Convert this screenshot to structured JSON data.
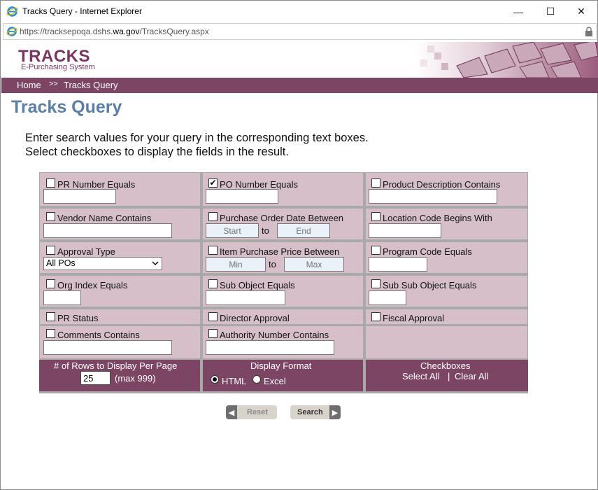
{
  "window": {
    "title": "Tracks Query - Internet Explorer",
    "minimize": "—",
    "maximize": "☐",
    "close": "✕"
  },
  "address": {
    "url_prefix": "https://trackse",
    "url_mid": "poqa.dshs",
    "url_domain": ".wa.gov",
    "url_path": "/TracksQuery.aspx"
  },
  "banner": {
    "logo": "TRACKS",
    "subtitle": "E-Purchasing System"
  },
  "nav": {
    "home": "Home",
    "sep": ">>",
    "current": "Tracks Query"
  },
  "page_title": "Tracks Query",
  "intro": {
    "line1": "Enter search values for your query in the corresponding text boxes.",
    "line2": "Select checkboxes to display the fields in the result."
  },
  "fields": {
    "pr_number": {
      "label": "PR Number Equals",
      "checked": false,
      "value": ""
    },
    "po_number": {
      "label": "PO Number Equals",
      "checked": true,
      "value": ""
    },
    "product_desc": {
      "label": "Product Description Contains",
      "checked": false,
      "value": ""
    },
    "vendor_name": {
      "label": "Vendor Name Contains",
      "checked": false,
      "value": ""
    },
    "po_date": {
      "label": "Purchase Order Date Between",
      "checked": false,
      "start": "Start",
      "to": "to",
      "end": "End"
    },
    "location_code": {
      "label": "Location Code Begins With",
      "checked": false,
      "value": ""
    },
    "approval_type": {
      "label": "Approval Type",
      "checked": false,
      "selected": "All POs"
    },
    "item_price": {
      "label": "Item Purchase Price Between",
      "checked": false,
      "min": "Min",
      "to": "to",
      "max": "Max"
    },
    "program_code": {
      "label": "Program Code Equals",
      "checked": false,
      "value": ""
    },
    "org_index": {
      "label": "Org Index Equals",
      "checked": false,
      "value": ""
    },
    "sub_object": {
      "label": "Sub Object Equals",
      "checked": false,
      "value": ""
    },
    "sub_sub_object": {
      "label": "Sub Sub Object Equals",
      "checked": false,
      "value": ""
    },
    "pr_status": {
      "label": "PR Status",
      "checked": false
    },
    "director_approval": {
      "label": "Director Approval",
      "checked": false
    },
    "fiscal_approval": {
      "label": "Fiscal Approval",
      "checked": false
    },
    "comments": {
      "label": "Comments Contains",
      "checked": false,
      "value": ""
    },
    "authority_number": {
      "label": "Authority Number Contains",
      "checked": false,
      "value": ""
    }
  },
  "options": {
    "rows_label": "# of Rows to Display Per Page",
    "rows_value": "25",
    "rows_max": "(max 999)",
    "format_label": "Display Format",
    "format_html": "HTML",
    "format_excel": "Excel",
    "format_selected": "HTML",
    "checkboxes_label": "Checkboxes",
    "select_all": "Select All",
    "divider": "|",
    "clear_all": "Clear All"
  },
  "buttons": {
    "reset": "Reset",
    "search": "Search"
  },
  "colors": {
    "nav": "#7c4564",
    "cell": "#d6bfc9",
    "title": "#5b7fa6",
    "logo": "#7b3560"
  }
}
